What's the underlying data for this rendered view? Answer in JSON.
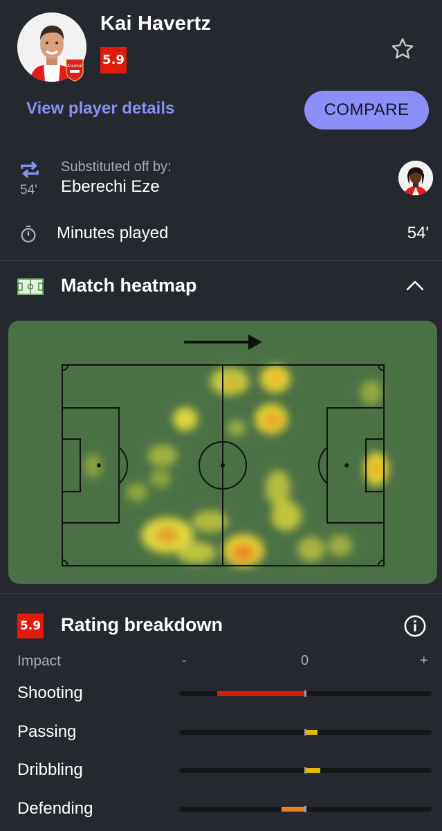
{
  "player": {
    "name": "Kai Havertz",
    "rating": "5.9",
    "rating_color": "#e01b0c",
    "club_badge_text": "Arsenal",
    "favorite_icon": "star-outline-icon"
  },
  "actions": {
    "details_link": "View player details",
    "compare_button": "COMPARE"
  },
  "substitution": {
    "icon": "swap-arrows-icon",
    "minute": "54'",
    "label": "Substituted off by:",
    "replacement": "Eberechi Eze"
  },
  "minutes": {
    "icon": "stopwatch-icon",
    "label": "Minutes played",
    "value": "54'"
  },
  "heatmap": {
    "icon": "pitch-icon",
    "title": "Match heatmap",
    "toggle_icon": "chevron-up-icon",
    "direction_icon": "arrow-right-icon"
  },
  "breakdown": {
    "rating": "5.9",
    "title": "Rating breakdown",
    "info_icon": "info-icon",
    "axis": {
      "label": "Impact",
      "minus": "-",
      "zero": "0",
      "plus": "+"
    },
    "rows": [
      {
        "label": "Shooting",
        "impact": -0.69,
        "color": "#d81b10"
      },
      {
        "label": "Passing",
        "impact": 0.09,
        "color": "#e6b800"
      },
      {
        "label": "Dribbling",
        "impact": 0.11,
        "color": "#e6b800"
      },
      {
        "label": "Defending",
        "impact": -0.18,
        "color": "#e8801e"
      }
    ]
  }
}
